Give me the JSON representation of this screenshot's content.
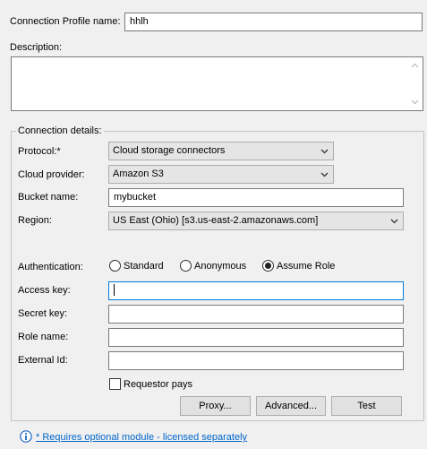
{
  "profile": {
    "name_label": "Connection Profile name:",
    "name_value": "hhlh",
    "description_label": "Description:",
    "description_value": ""
  },
  "connection": {
    "group_title": "Connection details:",
    "protocol_label": "Protocol:*",
    "protocol_value": "Cloud storage connectors",
    "provider_label": "Cloud provider:",
    "provider_value": "Amazon S3",
    "bucket_label": "Bucket name:",
    "bucket_value": "mybucket",
    "region_label": "Region:",
    "region_value": "US East (Ohio) [s3.us-east-2.amazonaws.com]",
    "auth_label": "Authentication:",
    "auth_options": [
      "Standard",
      "Anonymous",
      "Assume Role"
    ],
    "auth_selected": "Assume Role",
    "access_key_label": "Access key:",
    "access_key_value": "",
    "secret_key_label": "Secret key:",
    "secret_key_value": "",
    "role_name_label": "Role name:",
    "role_name_value": "",
    "external_id_label": "External Id:",
    "external_id_value": "",
    "requestor_pays_label": "Requestor pays",
    "requestor_pays_checked": false
  },
  "buttons": {
    "proxy": "Proxy...",
    "advanced": "Advanced...",
    "test": "Test"
  },
  "footer": {
    "note": "* Requires optional module - licensed separately"
  },
  "icons": {
    "info": "info-icon",
    "dropdown": "chevron-down-icon"
  },
  "colors": {
    "focus_border": "#0078d7",
    "link": "#0066cc",
    "info_icon": "#1e64c8"
  }
}
